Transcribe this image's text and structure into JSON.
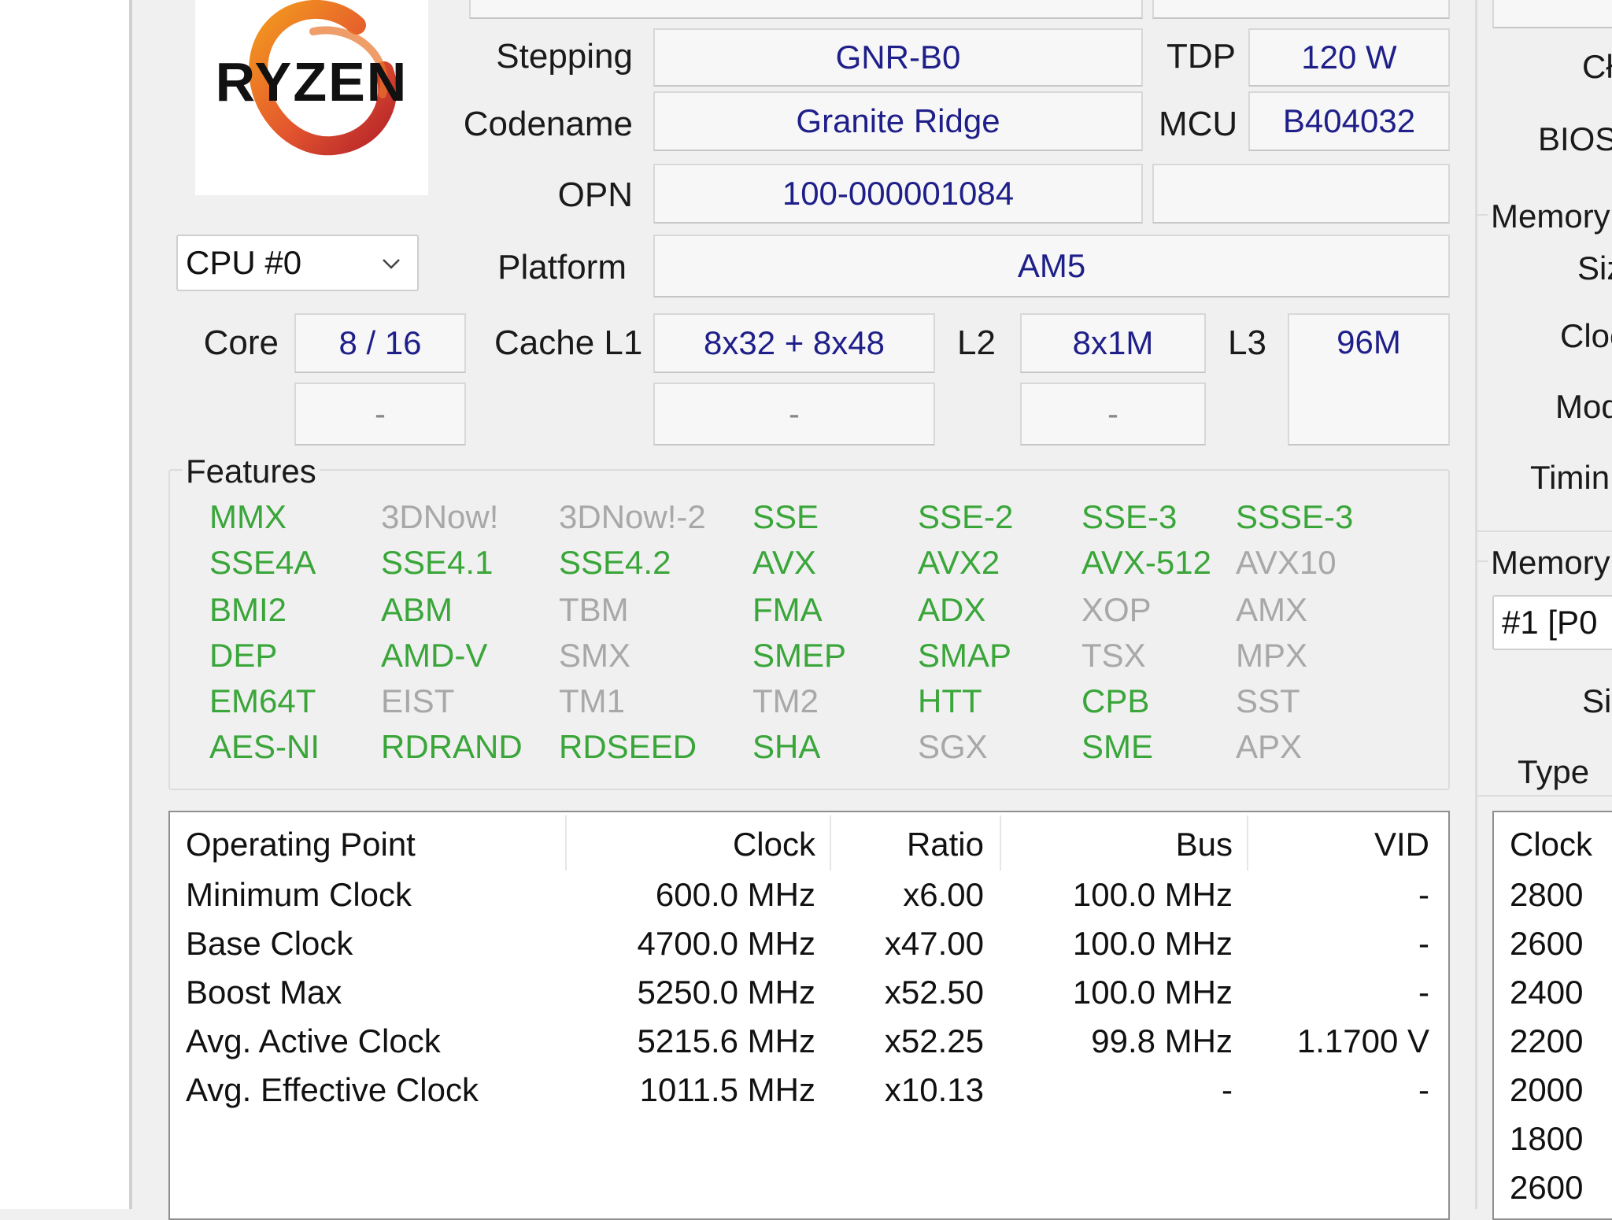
{
  "cpu_selector": {
    "value": "CPU #0"
  },
  "spec": {
    "stepping_label": "Stepping",
    "stepping_value": "GNR-B0",
    "tdp_label": "TDP",
    "tdp_value": "120 W",
    "codename_label": "Codename",
    "codename_value": "Granite Ridge",
    "mcu_label": "MCU",
    "mcu_value": "B404032",
    "opn_label": "OPN",
    "opn_value": "100-000001084",
    "platform_label": "Platform",
    "platform_value": "AM5"
  },
  "cores": {
    "core_label": "Core",
    "core_value": "8 / 16",
    "core_sub": "-",
    "cache_l1_label": "Cache L1",
    "cache_l1_value": "8x32 + 8x48",
    "cache_l1_sub": "-",
    "l2_label": "L2",
    "l2_value": "8x1M",
    "l2_sub": "-",
    "l3_label": "L3",
    "l3_value": "96M"
  },
  "features": {
    "title": "Features",
    "rows": [
      [
        {
          "t": "MMX",
          "on": true
        },
        {
          "t": "3DNow!",
          "on": false
        },
        {
          "t": "3DNow!-2",
          "on": false
        },
        {
          "t": "SSE",
          "on": true
        },
        {
          "t": "SSE-2",
          "on": true
        },
        {
          "t": "SSE-3",
          "on": true
        },
        {
          "t": "SSSE-3",
          "on": true
        }
      ],
      [
        {
          "t": "SSE4A",
          "on": true
        },
        {
          "t": "SSE4.1",
          "on": true
        },
        {
          "t": "SSE4.2",
          "on": true
        },
        {
          "t": "AVX",
          "on": true
        },
        {
          "t": "AVX2",
          "on": true
        },
        {
          "t": "AVX-512",
          "on": true
        },
        {
          "t": "AVX10",
          "on": false
        }
      ],
      [
        {
          "t": "BMI2",
          "on": true
        },
        {
          "t": "ABM",
          "on": true
        },
        {
          "t": "TBM",
          "on": false
        },
        {
          "t": "FMA",
          "on": true
        },
        {
          "t": "ADX",
          "on": true
        },
        {
          "t": "XOP",
          "on": false
        },
        {
          "t": "AMX",
          "on": false
        }
      ],
      [
        {
          "t": "DEP",
          "on": true
        },
        {
          "t": "AMD-V",
          "on": true
        },
        {
          "t": "SMX",
          "on": false
        },
        {
          "t": "SMEP",
          "on": true
        },
        {
          "t": "SMAP",
          "on": true
        },
        {
          "t": "TSX",
          "on": false
        },
        {
          "t": "MPX",
          "on": false
        }
      ],
      [
        {
          "t": "EM64T",
          "on": true
        },
        {
          "t": "EIST",
          "on": false
        },
        {
          "t": "TM1",
          "on": false
        },
        {
          "t": "TM2",
          "on": false
        },
        {
          "t": "HTT",
          "on": true
        },
        {
          "t": "CPB",
          "on": true
        },
        {
          "t": "SST",
          "on": false
        }
      ],
      [
        {
          "t": "AES-NI",
          "on": true
        },
        {
          "t": "RDRAND",
          "on": true
        },
        {
          "t": "RDSEED",
          "on": true
        },
        {
          "t": "SHA",
          "on": true
        },
        {
          "t": "SGX",
          "on": false
        },
        {
          "t": "SME",
          "on": true
        },
        {
          "t": "APX",
          "on": false
        }
      ]
    ]
  },
  "op_table": {
    "headers": [
      "Operating Point",
      "Clock",
      "Ratio",
      "Bus",
      "VID"
    ],
    "rows": [
      [
        "Minimum Clock",
        "600.0 MHz",
        "x6.00",
        "100.0 MHz",
        "-"
      ],
      [
        "Base Clock",
        "4700.0 MHz",
        "x47.00",
        "100.0 MHz",
        "-"
      ],
      [
        "Boost Max",
        "5250.0 MHz",
        "x52.50",
        "100.0 MHz",
        "-"
      ],
      [
        "Avg. Active Clock",
        "5215.6 MHz",
        "x52.25",
        "99.8 MHz",
        "1.1700 V"
      ],
      [
        "Avg. Effective Clock",
        "1011.5 MHz",
        "x10.13",
        "-",
        "-"
      ]
    ]
  },
  "right_panel": {
    "label_ch": "Cł",
    "label_bios": "BIOS",
    "memory_title_1": "Memory",
    "label_size": "Siz",
    "label_clock": "Cloc",
    "label_mode": "Mod",
    "label_timing": "Timin",
    "memory_title_2": "Memory",
    "slot_select": "#1 [P0",
    "label_size2": "Si",
    "label_type": "Type",
    "clock_header": "Clock",
    "clock_values": [
      "2800",
      "2600",
      "2400",
      "2200",
      "2000",
      "1800",
      "2600"
    ]
  },
  "colors": {
    "feature_on": "#3aa63a",
    "feature_off": "#a8a8a8",
    "value_text": "#1f1f8a"
  }
}
